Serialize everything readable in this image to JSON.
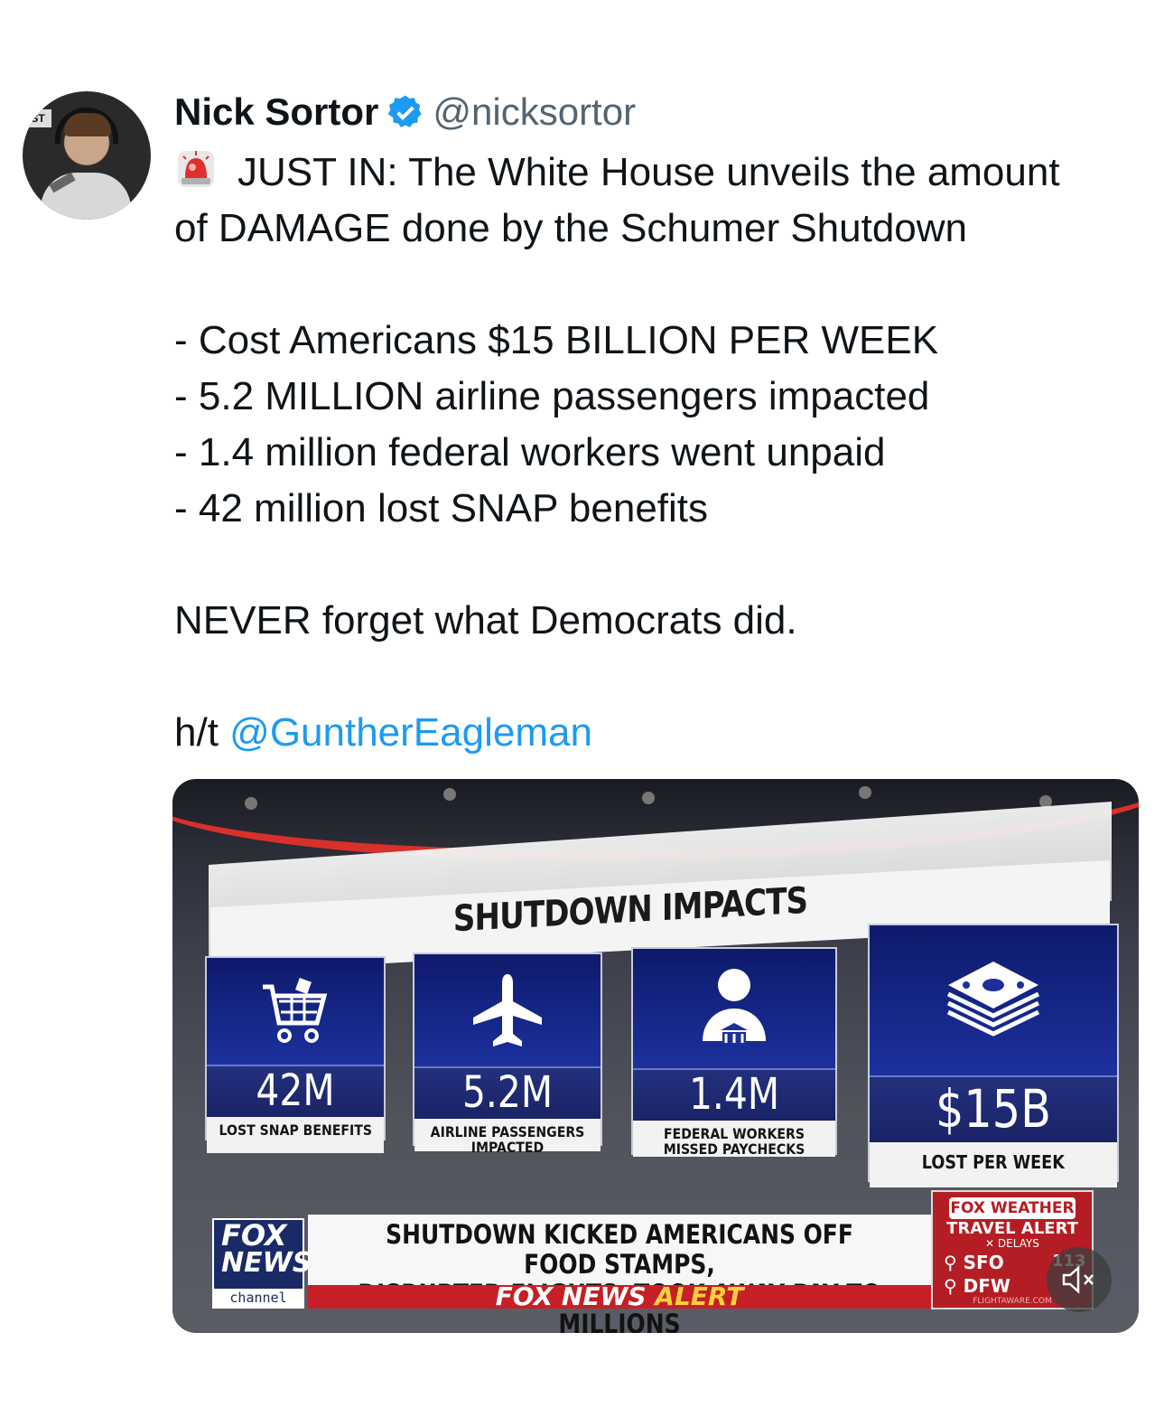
{
  "author": {
    "name": "Nick Sortor",
    "handle": "@nicksortor",
    "avatar_badge": "ST"
  },
  "tweet": {
    "line1": "JUST IN: The White House unveils the amount",
    "line2": "of DAMAGE done by the Schumer Shutdown",
    "bullets": [
      "- Cost Americans $15 BILLION PER WEEK",
      "- 5.2 MILLION airline passengers impacted",
      "- 1.4 million federal workers went unpaid",
      "- 42 million lost SNAP benefits"
    ],
    "closing": "NEVER forget what Democrats did.",
    "ht_prefix": "h/t",
    "ht_mention": "@GuntherEagleman"
  },
  "media": {
    "title": "SHUTDOWN IMPACTS",
    "stats": [
      {
        "value": "42M",
        "label": "LOST SNAP BENEFITS",
        "icon": "shopping-cart-icon"
      },
      {
        "value": "5.2M",
        "label": "AIRLINE PASSENGERS IMPACTED",
        "icon": "airplane-icon"
      },
      {
        "value": "1.4M",
        "label": "FEDERAL WORKERS MISSED PAYCHECKS",
        "icon": "federal-worker-icon"
      },
      {
        "value": "$15B",
        "label": "LOST PER WEEK",
        "icon": "money-stack-icon"
      }
    ],
    "logo_fox": "FOX",
    "logo_news": "NEWS",
    "logo_channel": "channel",
    "headline_1": "SHUTDOWN KICKED AMERICANS OFF FOOD STAMPS,",
    "headline_2": "DISRUPTED FLIGHTS, TOOK AWAY PAY TO MILLIONS",
    "alert_fox_news": "FOX NEWS",
    "alert_word": "ALERT",
    "weather_logo": "FOX WEATHER",
    "weather_title": "TRAVEL ALERT",
    "weather_delays": "✕ DELAYS",
    "weather_airport_1": "SFO",
    "weather_airport_2": "DFW",
    "weather_num": "113",
    "weather_footer": "FLIGHTAWARE.COM"
  },
  "colors": {
    "mention_blue": "#1d9bf0",
    "verified_blue": "#1d9bf0",
    "fox_red": "#c62026"
  }
}
